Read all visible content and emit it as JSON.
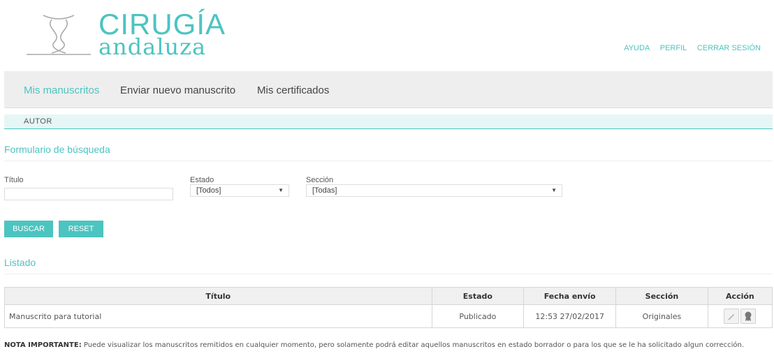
{
  "brand": {
    "line1": "CIRUGÍA",
    "line2": "andaluza"
  },
  "topnav": {
    "ayuda": "AYUDA",
    "perfil": "PERFIL",
    "cerrar": "CERRAR SESIÓN"
  },
  "mainnav": {
    "items": [
      "Mis manuscritos",
      "Enviar nuevo manuscrito",
      "Mis certificados"
    ]
  },
  "role": "AUTOR",
  "search": {
    "title": "Formulario de búsqueda",
    "titulo_label": "Título",
    "titulo_value": "",
    "estado_label": "Estado",
    "estado_value": "[Todos]",
    "seccion_label": "Sección",
    "seccion_value": "[Todas]",
    "buscar": "BUSCAR",
    "reset": "RESET"
  },
  "listado": {
    "title": "Listado",
    "headers": [
      "Título",
      "Estado",
      "Fecha envío",
      "Sección",
      "Acción"
    ],
    "rows": [
      {
        "titulo": "Manuscrito para tutorial",
        "estado": "Publicado",
        "fecha": "12:53 27/02/2017",
        "seccion": "Originales"
      }
    ]
  },
  "nota": {
    "bold": "NOTA IMPORTANTE:",
    "text": " Puede visualizar los manuscritos remitidos en cualquier momento, pero solamente podrá editar aquellos manuscritos en estado borrador o para los que se le ha solicitado algun corrección."
  },
  "colors": {
    "accent": "#4cc4c0",
    "nav_bg": "#eeeeee",
    "role_bg": "#e6f6f6"
  }
}
